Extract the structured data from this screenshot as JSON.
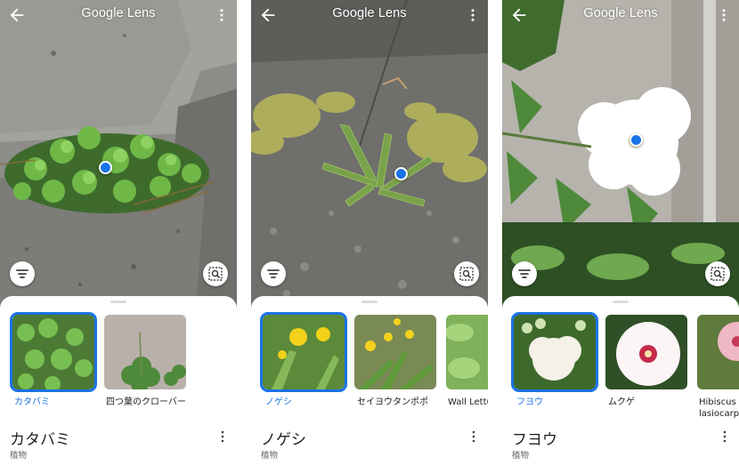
{
  "app": {
    "title": "Google Lens",
    "accent_color": "#1a73e8",
    "icons": {
      "back": "arrow-left-icon",
      "more": "more-vert-icon",
      "filter": "filter-icon",
      "crop_search": "image-search-icon"
    }
  },
  "panels": [
    {
      "results": [
        {
          "label": "カタバミ",
          "selected": true
        },
        {
          "label": "四つ葉のクローバー",
          "selected": false
        }
      ],
      "name": "カタバミ",
      "category": "植物"
    },
    {
      "results": [
        {
          "label": "ノゲシ",
          "selected": true
        },
        {
          "label": "セイヨウタンポポ",
          "selected": false
        },
        {
          "label": "Wall Lettu",
          "selected": false
        }
      ],
      "name": "ノゲシ",
      "category": "植物"
    },
    {
      "results": [
        {
          "label": "フヨウ",
          "selected": true
        },
        {
          "label": "ムクゲ",
          "selected": false
        },
        {
          "label": "Hibiscus\nlasiocarp",
          "selected": false
        }
      ],
      "name": "フヨウ",
      "category": "植物"
    }
  ]
}
